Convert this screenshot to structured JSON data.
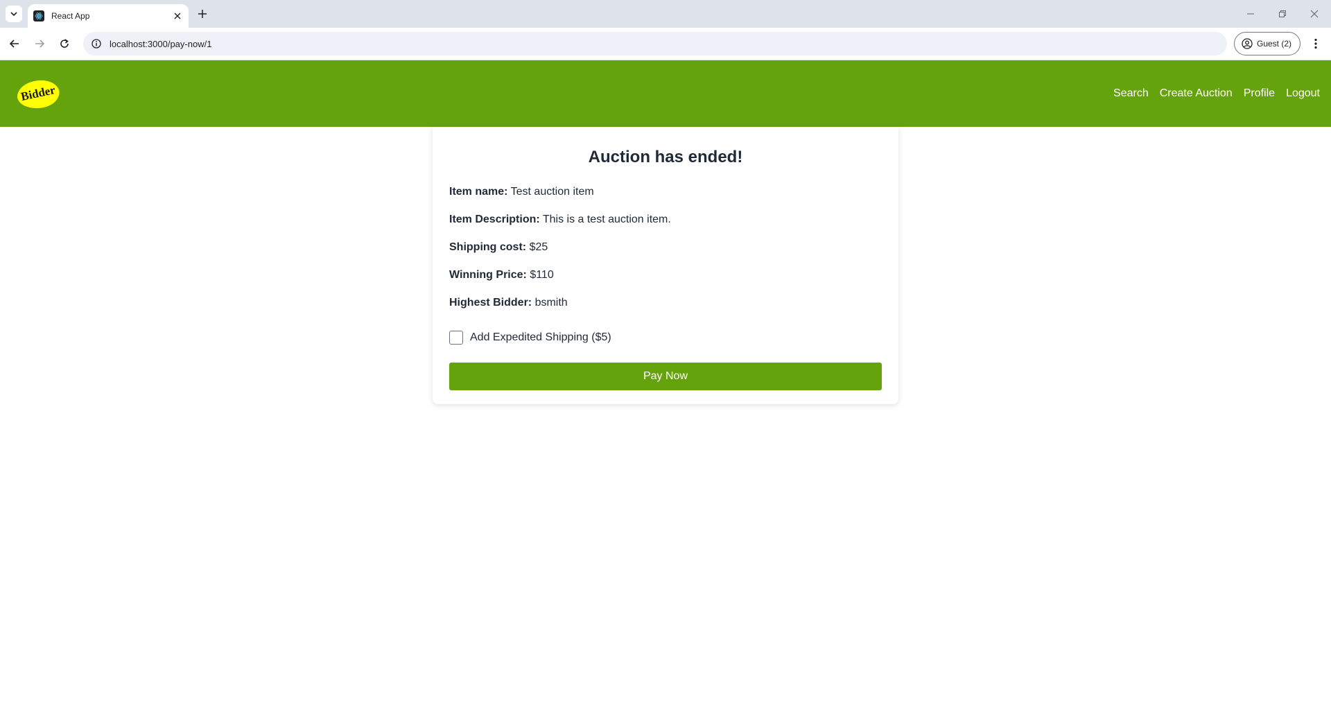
{
  "browser": {
    "tab_title": "React App",
    "url": "localhost:3000/pay-now/1",
    "profile_label": "Guest (2)"
  },
  "header": {
    "logo_text": "Bidder",
    "brand_color": "#65a30d",
    "logo_color": "#ffff00",
    "nav": {
      "search": "Search",
      "create_auction": "Create Auction",
      "profile": "Profile",
      "logout": "Logout"
    }
  },
  "card": {
    "title": "Auction has ended!",
    "fields": [
      {
        "label": "Item name:",
        "value": "Test auction item"
      },
      {
        "label": "Item Description:",
        "value": "This is a test auction item."
      },
      {
        "label": "Shipping cost:",
        "value": "$25"
      },
      {
        "label": "Winning Price:",
        "value": "$110"
      },
      {
        "label": "Highest Bidder:",
        "value": "bsmith"
      }
    ],
    "checkbox_label": "Add Expedited Shipping ($5)",
    "checkbox_checked": false,
    "pay_button": "Pay Now"
  }
}
